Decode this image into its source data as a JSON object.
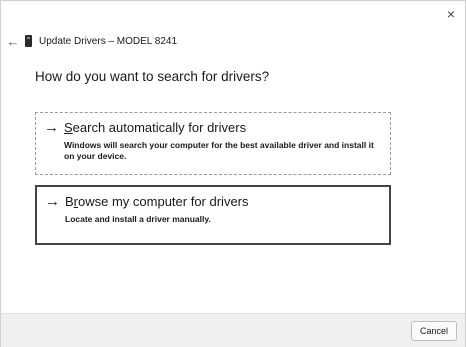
{
  "window": {
    "title": "Update Drivers – MODEL 8241",
    "close_glyph": "×",
    "back_glyph": "←",
    "back_icon": "back-arrow-icon",
    "close_icon": "close-icon",
    "device_icon": "device-icon"
  },
  "heading": "How do you want to search for drivers?",
  "options": [
    {
      "arrow": "→",
      "title_accel": "S",
      "title_rest": "earch automatically for drivers",
      "description": "Windows will search your computer for the best available driver and install it on your device."
    },
    {
      "arrow": "→",
      "title_pre": "B",
      "title_accel": "r",
      "title_rest": "owse my computer for drivers",
      "description": "Locate and install a driver manually."
    }
  ],
  "footer": {
    "cancel_label": "Cancel"
  }
}
